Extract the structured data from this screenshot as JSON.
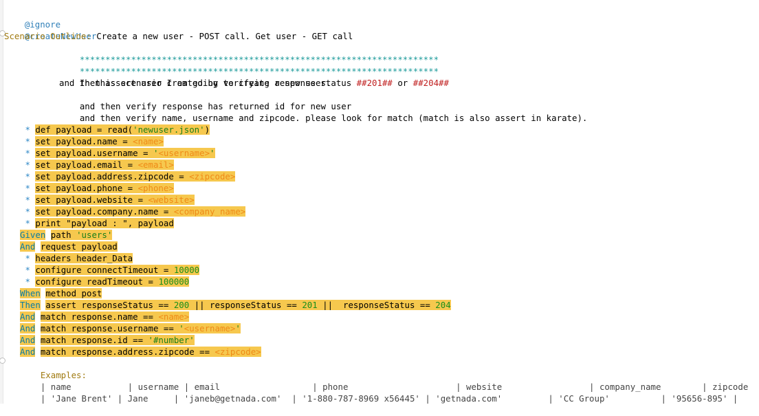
{
  "tags": [
    "@ignore",
    "@createNewUser"
  ],
  "scenario": {
    "keyword": "Scenario Outline:",
    "title": "Create a new user - POST call. Get user - GET call"
  },
  "stars_line": "**********************************************************************",
  "description": [
    "In this scenario I am going to create a new user.",
    "and then assert user created by verifying response status ##201## or ##204##",
    "and then verify response has returned id for new user",
    "and then verify name, username and zipcode. please look for match (match is also assert in karate)."
  ],
  "description_highlight": {
    "prefix": "and then assert user created by verifying response status ",
    "status1": "##201##",
    "mid": " or ",
    "status2": "##204##"
  },
  "steps": [
    {
      "kw": "*",
      "parts": [
        [
          "t",
          "def payload = read("
        ],
        [
          "s",
          "'newuser.json'"
        ],
        [
          "t",
          ")"
        ]
      ]
    },
    {
      "kw": "*",
      "parts": [
        [
          "t",
          "set payload.name = "
        ],
        [
          "p",
          "<name>"
        ]
      ]
    },
    {
      "kw": "*",
      "parts": [
        [
          "t",
          "set payload.username = "
        ],
        [
          "s",
          "'"
        ],
        [
          "p",
          "<username>"
        ],
        [
          "s",
          "'"
        ]
      ]
    },
    {
      "kw": "*",
      "parts": [
        [
          "t",
          "set payload.email = "
        ],
        [
          "p",
          "<email>"
        ]
      ]
    },
    {
      "kw": "*",
      "parts": [
        [
          "t",
          "set payload.address.zipcode = "
        ],
        [
          "p",
          "<zipcode>"
        ]
      ]
    },
    {
      "kw": "*",
      "parts": [
        [
          "t",
          "set payload.phone = "
        ],
        [
          "p",
          "<phone>"
        ]
      ]
    },
    {
      "kw": "*",
      "parts": [
        [
          "t",
          "set payload.website = "
        ],
        [
          "p",
          "<website>"
        ]
      ]
    },
    {
      "kw": "*",
      "parts": [
        [
          "t",
          "set payload.company.name = "
        ],
        [
          "p",
          "<company_name>"
        ]
      ]
    },
    {
      "kw": "*",
      "parts": [
        [
          "t",
          "print "
        ],
        [
          "t",
          "\"payload : \""
        ],
        [
          "t",
          ", payload"
        ]
      ]
    },
    {
      "kw": "Given",
      "parts": [
        [
          "t",
          "path "
        ],
        [
          "s",
          "'users'"
        ]
      ]
    },
    {
      "kw": "And",
      "parts": [
        [
          "t",
          "request payload"
        ]
      ]
    },
    {
      "kw": "*",
      "parts": [
        [
          "t",
          "headers header_Data"
        ]
      ]
    },
    {
      "kw": "*",
      "parts": [
        [
          "t",
          "configure connectTimeout = "
        ],
        [
          "n",
          "10000"
        ]
      ]
    },
    {
      "kw": "*",
      "parts": [
        [
          "t",
          "configure readTimeout = "
        ],
        [
          "n",
          "100000"
        ]
      ]
    },
    {
      "kw": "When",
      "parts": [
        [
          "t",
          "method post"
        ]
      ]
    },
    {
      "kw": "Then",
      "parts": [
        [
          "t",
          "assert responseStatus == "
        ],
        [
          "n",
          "200"
        ],
        [
          "t",
          " || responseStatus == "
        ],
        [
          "n",
          "201"
        ],
        [
          "t",
          " ||  responseStatus == "
        ],
        [
          "n",
          "204"
        ]
      ]
    },
    {
      "kw": "And",
      "parts": [
        [
          "t",
          "match response.name == "
        ],
        [
          "p",
          "<name>"
        ]
      ]
    },
    {
      "kw": "And",
      "parts": [
        [
          "t",
          "match response.username == "
        ],
        [
          "s",
          "'"
        ],
        [
          "p",
          "<username>"
        ],
        [
          "s",
          "'"
        ]
      ]
    },
    {
      "kw": "And",
      "parts": [
        [
          "t",
          "match response.id == "
        ],
        [
          "s",
          "'#number'"
        ]
      ]
    },
    {
      "kw": "And",
      "parts": [
        [
          "t",
          "match response.address.zipcode == "
        ],
        [
          "p",
          "<zipcode>"
        ]
      ]
    }
  ],
  "examples": {
    "keyword": "Examples:",
    "header_line": "| name           | username | email                  | phone                     | website                 | company_name        | zipcode      |",
    "row_line": "| 'Jane Brent' | Jane     | 'janeb@getnada.com'  | '1-880-787-8969 x56445' | 'getnada.com'         | 'CC Group'          | '95656-895' |"
  },
  "colors": {
    "highlight": "#f6c84e",
    "keyword": "#0a7ca3",
    "string": "#1a7f1a",
    "placeholder": "#ef8a17",
    "tag": "#2f7fb8"
  }
}
